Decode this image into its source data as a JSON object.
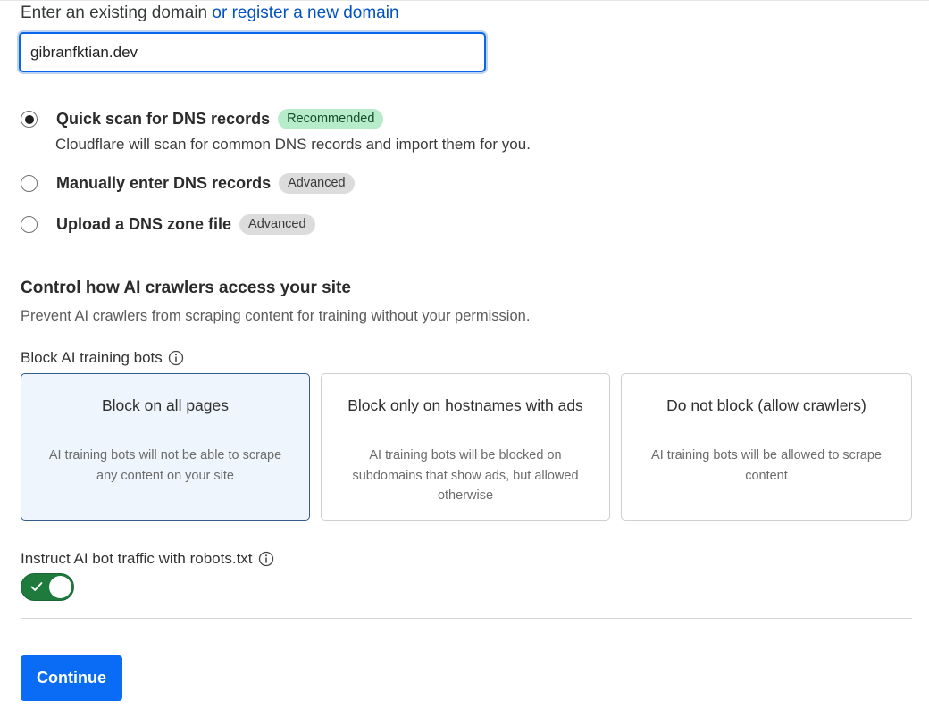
{
  "domain": {
    "label": "Enter an existing domain",
    "register_link": "or register a new domain",
    "input_value": "gibranfktian.dev"
  },
  "scan_options": [
    {
      "label": "Quick scan for DNS records",
      "badge": "Recommended",
      "selected": true,
      "description": "Cloudflare will scan for common DNS records and import them for you."
    },
    {
      "label": "Manually enter DNS records",
      "badge": "Advanced",
      "selected": false
    },
    {
      "label": "Upload a DNS zone file",
      "badge": "Advanced",
      "selected": false
    }
  ],
  "ai_crawlers": {
    "title": "Control how AI crawlers access your site",
    "description": "Prevent AI crawlers from scraping content for training without your permission.",
    "block_label": "Block AI training bots",
    "cards": [
      {
        "title": "Block on all pages",
        "description": "AI training bots will not be able to scrape any content on your site",
        "selected": true
      },
      {
        "title": "Block only on hostnames with ads",
        "description": "AI training bots will be blocked on subdomains that show ads, but allowed otherwise",
        "selected": false
      },
      {
        "title": "Do not block (allow crawlers)",
        "description": "AI training bots will be allowed to scrape content",
        "selected": false
      }
    ],
    "robots_label": "Instruct AI bot traffic with robots.txt",
    "robots_enabled": true
  },
  "continue_label": "Continue",
  "icons": {
    "info": "info-icon",
    "check": "check-icon"
  },
  "colors": {
    "accent": "#0a6cf5",
    "link": "#0051c3",
    "toggle_on": "#1f7a3d",
    "recommended_badge": "#b6ecc9",
    "advanced_badge": "#dcdcdc"
  }
}
